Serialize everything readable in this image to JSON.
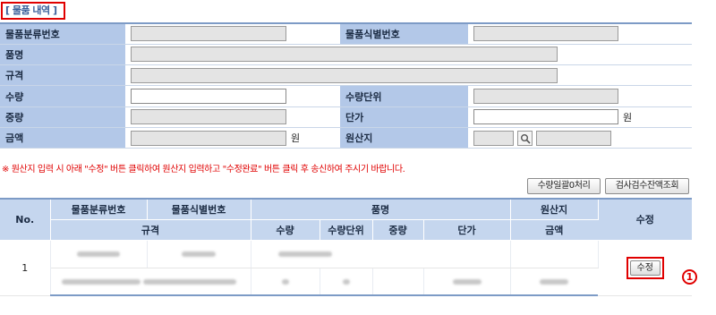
{
  "section": {
    "title": "[ 물품 내역 ]"
  },
  "form": {
    "classification_no_label": "물품분류번호",
    "identification_no_label": "물품식별번호",
    "item_name_label": "품명",
    "spec_label": "규격",
    "quantity_label": "수량",
    "quantity_unit_label": "수량단위",
    "weight_label": "중량",
    "unit_price_label": "단가",
    "unit_price_currency": "원",
    "amount_label": "금액",
    "amount_currency": "원",
    "origin_label": "원산지"
  },
  "notice": "※ 원산지 입력 시 아래 \"수정\" 버튼 클릭하여 원산지 입력하고 \"수정완료\" 버튼 클릭 후 송신하여 주시기 바랍니다.",
  "toolbar": {
    "reset_quantity_label": "수량일괄0처리",
    "inspection_balance_label": "검사검수잔액조회"
  },
  "grid": {
    "header_row1": {
      "no": "No.",
      "classification_no": "물품분류번호",
      "identification_no": "물품식별번호",
      "item_name": "품명",
      "origin": "원산지",
      "edit": "수정"
    },
    "header_row2": {
      "spec": "규격",
      "quantity": "수량",
      "quantity_unit": "수량단위",
      "weight": "중량",
      "unit_price": "단가",
      "amount": "금액"
    },
    "rows": [
      {
        "no": "1",
        "edit_label": "수정"
      }
    ]
  },
  "annotation": {
    "marker": "1"
  },
  "colors": {
    "label_bg": "#b3c8e8",
    "header_bg": "#c5d6ee",
    "highlight": "#e00000",
    "title_text": "#3a5f9a"
  }
}
